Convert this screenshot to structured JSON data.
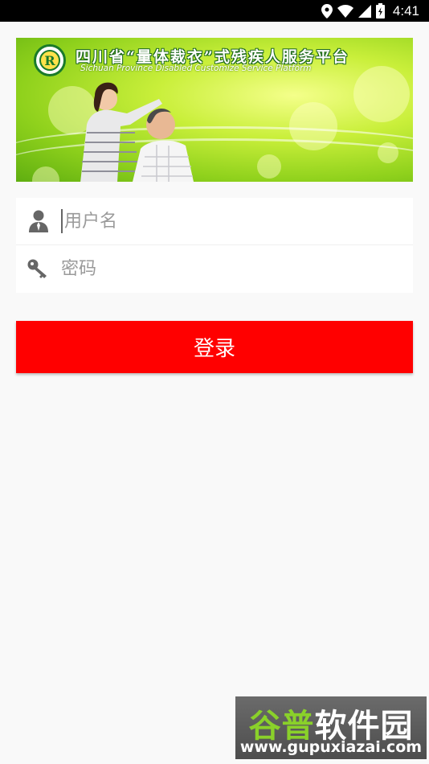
{
  "status_bar": {
    "time": "4:41",
    "icons": [
      "location-icon",
      "wifi-icon",
      "signal-icon",
      "battery-charging-icon"
    ]
  },
  "banner": {
    "title_cn": "四川省“量体裁衣”式残疾人服务平台",
    "title_en": "Sichuan Province Disabled Customize Service Platform",
    "logo_text": "R"
  },
  "login_form": {
    "username_placeholder": "用户名",
    "username_value": "",
    "password_placeholder": "密码",
    "password_value": ""
  },
  "login_button": {
    "label": "登录"
  },
  "watermark": {
    "brand_part1": "谷普",
    "brand_part2": "软件园",
    "url": "www.gupuxiazai.com"
  },
  "colors": {
    "accent": "#ff0000",
    "background": "#f9f9f9",
    "banner_green": "#8fd11c"
  }
}
